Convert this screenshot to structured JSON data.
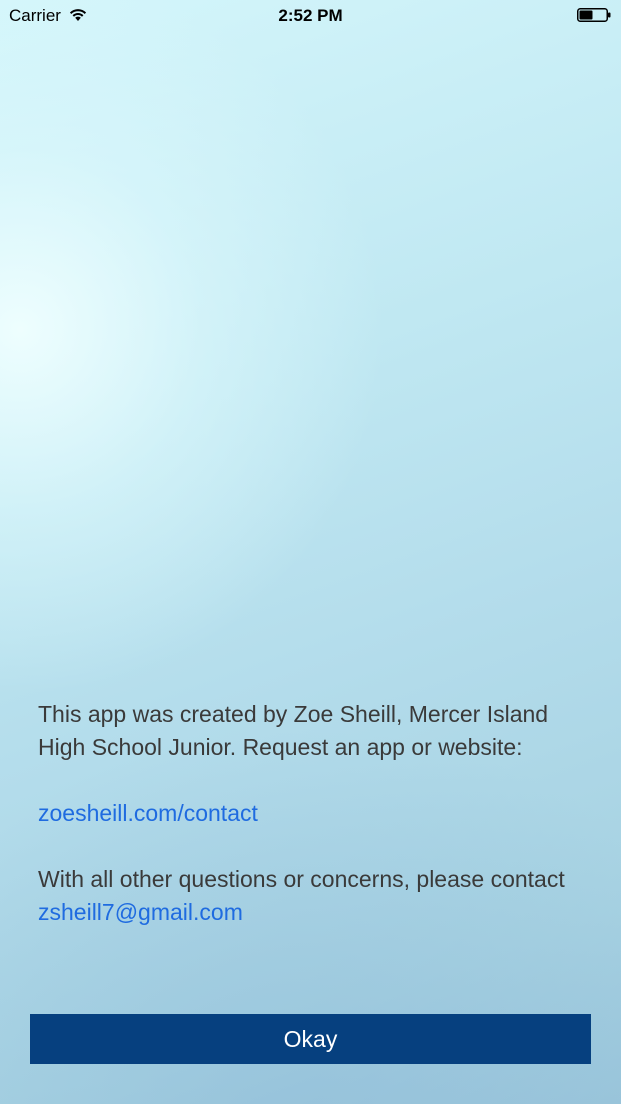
{
  "status_bar": {
    "carrier": "Carrier",
    "time": "2:52 PM",
    "wifi_icon": "wifi-icon",
    "battery_icon": "battery-icon",
    "battery_level": 0.5
  },
  "about": {
    "intro": "This app was created by Zoe Sheill, Mercer Island High School Junior.  Request an app or website:",
    "website_link": "zoesheill.com/contact",
    "contact_prefix": "With all other questions or concerns, please contact",
    "email_link": "zsheill7@gmail.com"
  },
  "okay_button": {
    "label": "Okay"
  },
  "colors": {
    "link": "#1f6be0",
    "button_bg": "#06407f",
    "button_text": "#ffffff",
    "body_text": "#3a3a3a"
  }
}
